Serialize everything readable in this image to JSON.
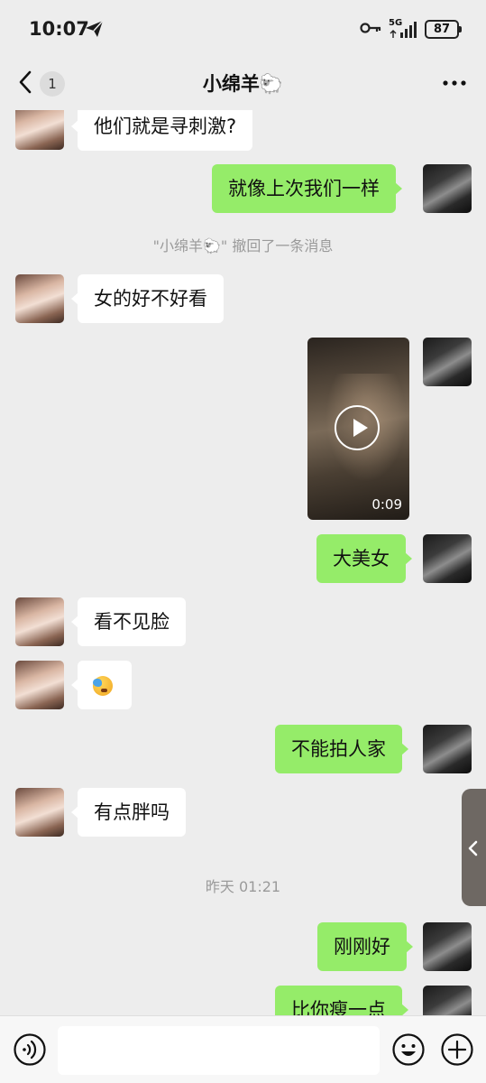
{
  "status_bar": {
    "time": "10:07",
    "network": "5G",
    "battery": "87"
  },
  "header": {
    "unread_count": "1",
    "title": "小绵羊🐑"
  },
  "messages": [
    {
      "side": "in",
      "type": "text",
      "text": "他们就是寻刺激?"
    },
    {
      "side": "out",
      "type": "text",
      "text": "就像上次我们一样"
    },
    {
      "type": "system",
      "text": "\"小绵羊🐑\" 撤回了一条消息"
    },
    {
      "side": "in",
      "type": "text",
      "text": "女的好不好看"
    },
    {
      "side": "out",
      "type": "video",
      "duration": "0:09"
    },
    {
      "side": "out",
      "type": "text",
      "text": "大美女"
    },
    {
      "side": "in",
      "type": "text",
      "text": "看不见脸"
    },
    {
      "side": "in",
      "type": "emoji",
      "emoji_name": "facepalm-crying-emoji"
    },
    {
      "side": "out",
      "type": "text",
      "text": "不能拍人家"
    },
    {
      "side": "in",
      "type": "text",
      "text": "有点胖吗"
    },
    {
      "type": "timestamp",
      "text": "昨天 01:21"
    },
    {
      "side": "out",
      "type": "text",
      "text": "刚刚好"
    },
    {
      "side": "out",
      "type": "text",
      "text": "比你瘦一点"
    }
  ],
  "input_bar": {
    "placeholder": ""
  },
  "icons": {
    "back": "chevron-left-icon",
    "more": "more-dots-icon",
    "voice": "voice-icon",
    "emoji": "emoji-icon",
    "plus": "plus-icon",
    "side_handle": "chevron-left-icon"
  },
  "colors": {
    "background": "#ededed",
    "incoming_bubble": "#ffffff",
    "outgoing_bubble": "#95ec69",
    "system_text": "#9a9a9a"
  }
}
